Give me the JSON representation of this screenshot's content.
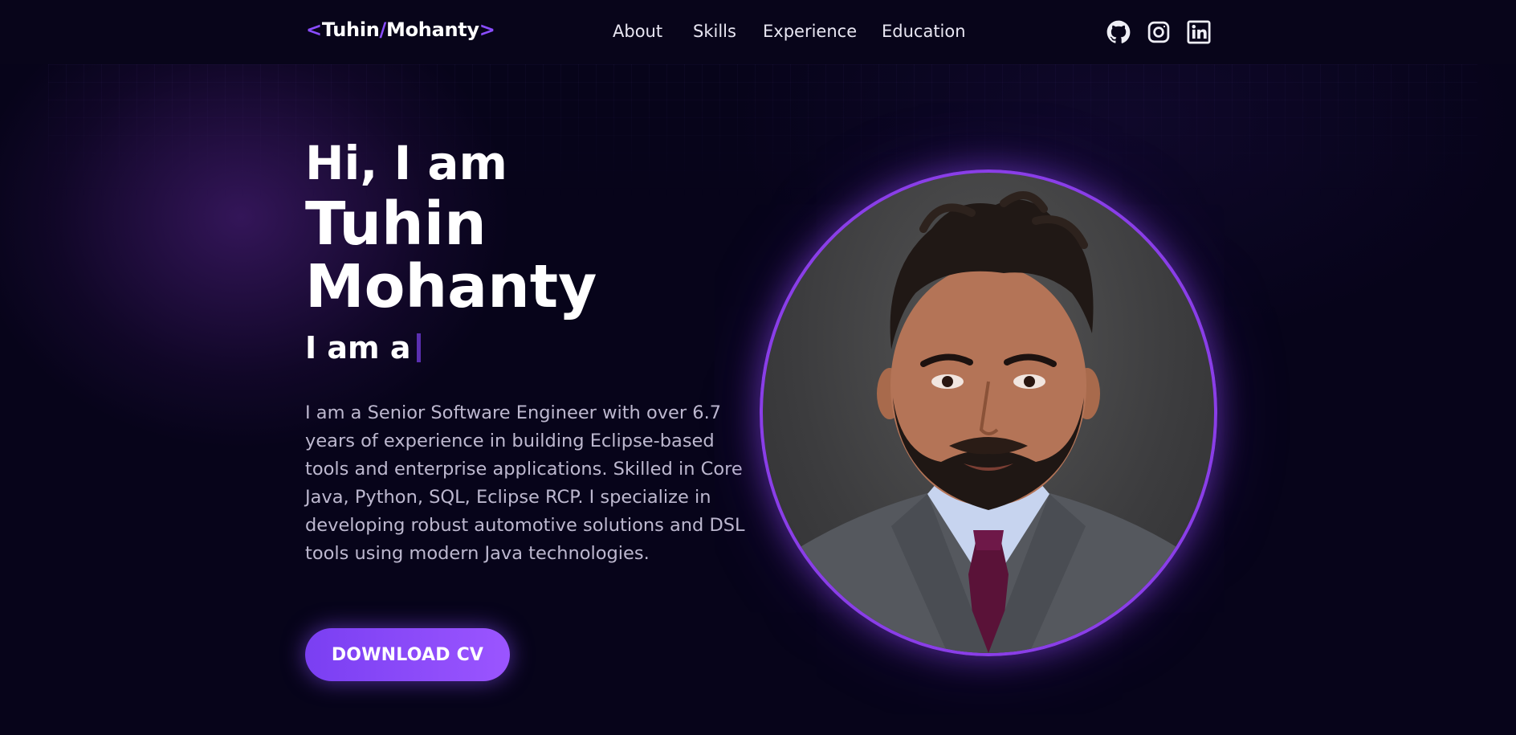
{
  "nav": {
    "logo": {
      "open": "<",
      "first": "Tuhin",
      "slash": "/",
      "last": "Mohanty",
      "close": ">"
    },
    "links": [
      "About",
      "Skills",
      "Experience",
      "Education"
    ],
    "social_icons": [
      "github-icon",
      "instagram-icon",
      "linkedin-icon"
    ]
  },
  "hero": {
    "greeting": "Hi, I am",
    "name_line1": "Tuhin",
    "name_line2": "Mohanty",
    "role_prefix": "I am a",
    "description": "I am a Senior Software Engineer with over 6.7 years of experience in building Eclipse-based tools and enterprise applications. Skilled in Core Java, Python, SQL, Eclipse RCP. I specialize in developing robust automotive solutions and DSL tools using modern Java technologies.",
    "cta_label": "DOWNLOAD CV"
  },
  "colors": {
    "background": "#07041a",
    "accent": "#8a4dff",
    "button": "#7a3ff2",
    "text_muted": "#bdb8cf"
  }
}
